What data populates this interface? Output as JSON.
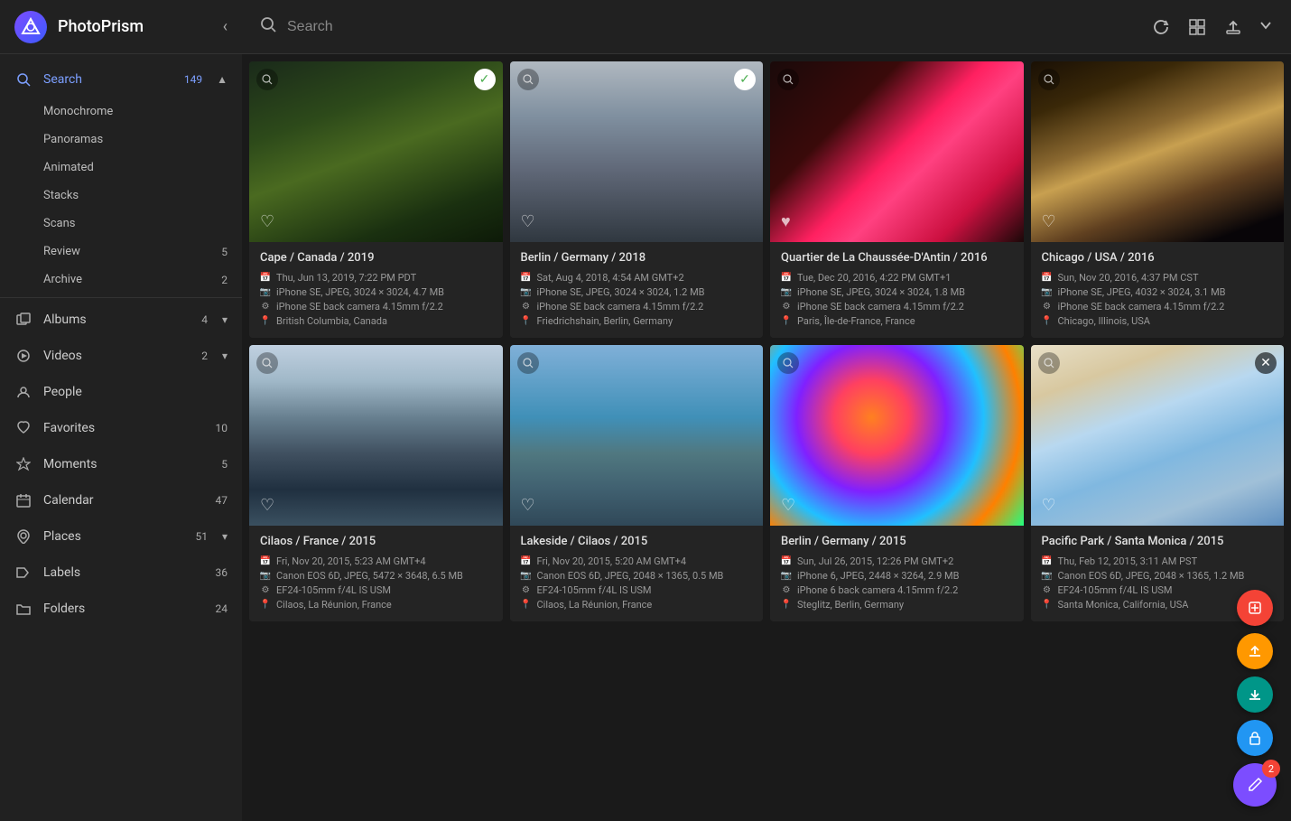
{
  "app": {
    "title": "PhotoPrism",
    "logo_alt": "PhotoPrism logo"
  },
  "topbar": {
    "search_placeholder": "Search",
    "refresh_icon": "↻",
    "grid_icon": "⊞",
    "upload_icon": "↑",
    "chevron_icon": "▾"
  },
  "sidebar": {
    "collapse_icon": "‹",
    "sections": [
      {
        "id": "search",
        "label": "Search",
        "icon": "🔍",
        "badge": "149",
        "active": true,
        "has_expand": true,
        "expanded": true
      }
    ],
    "sub_items": [
      {
        "label": "Monochrome"
      },
      {
        "label": "Panoramas"
      },
      {
        "label": "Animated"
      },
      {
        "label": "Stacks"
      },
      {
        "label": "Scans"
      },
      {
        "label": "Review",
        "badge": "5"
      },
      {
        "label": "Archive",
        "badge": "2"
      }
    ],
    "main_items": [
      {
        "id": "albums",
        "label": "Albums",
        "badge": "4",
        "has_expand": true
      },
      {
        "id": "videos",
        "label": "Videos",
        "badge": "2",
        "has_expand": true
      },
      {
        "id": "people",
        "label": "People",
        "badge": ""
      },
      {
        "id": "favorites",
        "label": "Favorites",
        "badge": "10"
      },
      {
        "id": "moments",
        "label": "Moments",
        "badge": "5"
      },
      {
        "id": "calendar",
        "label": "Calendar",
        "badge": "47"
      },
      {
        "id": "places",
        "label": "Places",
        "badge": "51",
        "has_expand": true
      },
      {
        "id": "labels",
        "label": "Labels",
        "badge": "36"
      },
      {
        "id": "folders",
        "label": "Folders",
        "badge": "24"
      }
    ]
  },
  "photos": [
    {
      "id": 1,
      "title": "Cape / Canada / 2019",
      "date": "Thu, Jun 13, 2019, 7:22 PM PDT",
      "camera": "iPhone SE, JPEG, 3024 × 3024, 4.7 MB",
      "lens": "iPhone SE back camera 4.15mm f/2.2",
      "location": "British Columbia, Canada",
      "has_check": true,
      "bg_class": "photo-1"
    },
    {
      "id": 2,
      "title": "Berlin / Germany / 2018",
      "date": "Sat, Aug 4, 2018, 4:54 AM GMT+2",
      "camera": "iPhone SE, JPEG, 3024 × 3024, 1.2 MB",
      "lens": "iPhone SE back camera 4.15mm f/2.2",
      "location": "Friedrichshain, Berlin, Germany",
      "has_check": true,
      "bg_class": "photo-2"
    },
    {
      "id": 3,
      "title": "Quartier de La Chaussée-D'Antin / 2016",
      "date": "Tue, Dec 20, 2016, 4:22 PM GMT+1",
      "camera": "iPhone SE, JPEG, 3024 × 3024, 1.8 MB",
      "lens": "iPhone SE back camera 4.15mm f/2.2",
      "location": "Paris, Île-de-France, France",
      "has_check": false,
      "bg_class": "photo-3"
    },
    {
      "id": 4,
      "title": "Chicago / USA / 2016",
      "date": "Sun, Nov 20, 2016, 4:37 PM CST",
      "camera": "iPhone SE, JPEG, 4032 × 3024, 3.1 MB",
      "lens": "iPhone SE back camera 4.15mm f/2.2",
      "location": "Chicago, Illinois, USA",
      "has_check": false,
      "bg_class": "photo-4"
    },
    {
      "id": 5,
      "title": "Cilaos / France / 2015",
      "date": "Fri, Nov 20, 2015, 5:23 AM GMT+4",
      "camera": "Canon EOS 6D, JPEG, 5472 × 3648, 6.5 MB",
      "lens": "EF24-105mm f/4L IS USM",
      "location": "Cilaos, La Réunion, France",
      "has_check": false,
      "bg_class": "photo-5"
    },
    {
      "id": 6,
      "title": "Lakeside / Cilaos / 2015",
      "date": "Fri, Nov 20, 2015, 5:20 AM GMT+4",
      "camera": "Canon EOS 6D, JPEG, 2048 × 1365, 0.5 MB",
      "lens": "EF24-105mm f/4L IS USM",
      "location": "Cilaos, La Réunion, France",
      "has_check": false,
      "bg_class": "photo-6"
    },
    {
      "id": 7,
      "title": "Berlin / Germany / 2015",
      "date": "Sun, Jul 26, 2015, 12:26 PM GMT+2",
      "camera": "iPhone 6, JPEG, 2448 × 3264, 2.9 MB",
      "lens": "iPhone 6 back camera 4.15mm f/2.2",
      "location": "Steglitz, Berlin, Germany",
      "has_check": false,
      "bg_class": "photo-7"
    },
    {
      "id": 8,
      "title": "Pacific Park / Santa Monica / 2015",
      "date": "Thu, Feb 12, 2015, 3:11 AM PST",
      "camera": "Canon EOS 6D, JPEG, 2048 × 1365, 1.2 MB",
      "lens": "EF24-105mm f/4L IS USM",
      "location": "Santa Monica, California, USA",
      "has_check": false,
      "has_close": true,
      "bg_class": "photo-8"
    }
  ],
  "fabs": [
    {
      "id": "fab-red",
      "color": "fab-red",
      "icon": "⊠"
    },
    {
      "id": "fab-orange",
      "color": "fab-orange",
      "icon": "↑"
    },
    {
      "id": "fab-teal",
      "color": "fab-teal",
      "icon": "↓"
    },
    {
      "id": "fab-blue",
      "color": "fab-blue",
      "icon": "🔒"
    },
    {
      "id": "fab-main",
      "color": "fab-main fab-main",
      "icon": "✎",
      "badge": "2"
    }
  ]
}
